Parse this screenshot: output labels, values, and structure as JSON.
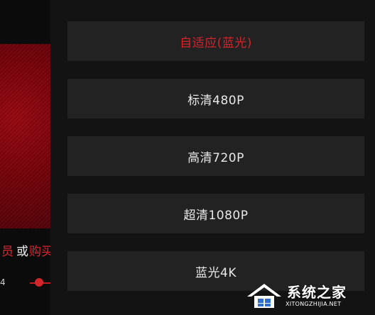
{
  "left": {
    "promo": {
      "member": "员",
      "or": "或",
      "buy": "购买"
    },
    "time_partial": "4"
  },
  "quality_panel": {
    "options": [
      {
        "label": "自适应(蓝光)",
        "selected": true
      },
      {
        "label": "标清480P",
        "selected": false
      },
      {
        "label": "高清720P",
        "selected": false
      },
      {
        "label": "超清1080P",
        "selected": false
      },
      {
        "label": "蓝光4K",
        "selected": false
      }
    ]
  },
  "watermark": {
    "title": "系统之家",
    "url": "XITONGZHIJIA.NET"
  },
  "colors": {
    "accent_red": "#d3242b",
    "panel_bg": "#131313",
    "option_bg": "#222222"
  }
}
